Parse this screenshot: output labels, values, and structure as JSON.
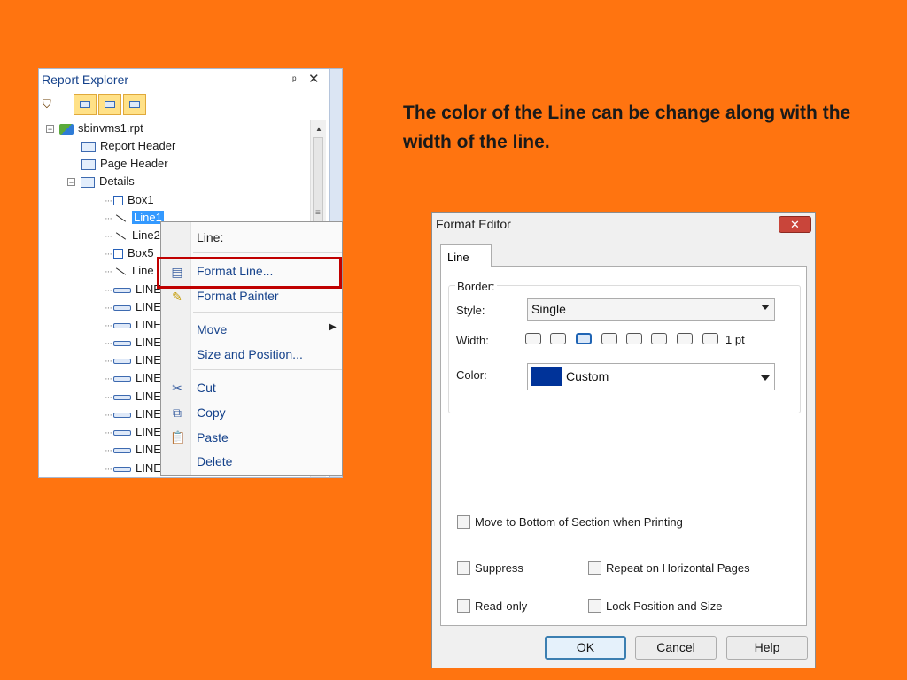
{
  "explorer": {
    "title": "Report Explorer",
    "pin_icon": "pin-icon",
    "close_icon": "close-icon",
    "tree": [
      {
        "label": "sbinvms1.rpt",
        "icon": "report-icon",
        "expander": "⊟"
      },
      {
        "label": "Report Header",
        "icon": "section-icon"
      },
      {
        "label": "Page Header",
        "icon": "section-icon"
      },
      {
        "label": "Details",
        "icon": "section-icon",
        "expander": "⊟"
      },
      {
        "label": "Box1",
        "icon": "box-icon"
      },
      {
        "label": "Line1",
        "icon": "line-icon",
        "selected": true
      },
      {
        "label": "Line2",
        "icon": "line-icon"
      },
      {
        "label": "Box5",
        "icon": "box-icon"
      },
      {
        "label": "Line",
        "icon": "line-icon"
      },
      {
        "label": "LINE",
        "icon": "label-icon"
      },
      {
        "label": "LINE",
        "icon": "label-icon"
      },
      {
        "label": "LINE",
        "icon": "label-icon"
      },
      {
        "label": "LINE",
        "icon": "label-icon"
      },
      {
        "label": "LINE",
        "icon": "label-icon"
      },
      {
        "label": "LINE",
        "icon": "label-icon"
      },
      {
        "label": "LINE",
        "icon": "label-icon"
      },
      {
        "label": "LINE",
        "icon": "label-icon"
      },
      {
        "label": "LINE",
        "icon": "label-icon"
      },
      {
        "label": "LINE",
        "icon": "label-icon"
      },
      {
        "label": "LINE",
        "icon": "label-icon"
      }
    ]
  },
  "context_menu": {
    "header": "Line:",
    "items": {
      "format_line": "Format Line...",
      "format_painter": "Format Painter",
      "move": "Move",
      "size_position": "Size and Position...",
      "cut": "Cut",
      "copy": "Copy",
      "paste": "Paste",
      "delete": "Delete"
    },
    "highlight_color": "#c00000"
  },
  "caption": "The color of the Line can be change along with the width of the line.",
  "dialog": {
    "title": "Format Editor",
    "tab": "Line",
    "border_group": "Border:",
    "style_label": "Style:",
    "style_value": "Single",
    "width_label": "Width:",
    "width_value": "1 pt",
    "color_label": "Color:",
    "color_value": "Custom",
    "color_swatch": "#003399",
    "options": {
      "move_to_bottom": "Move to Bottom of Section when Printing",
      "suppress": "Suppress",
      "repeat": "Repeat on Horizontal Pages",
      "read_only": "Read-only",
      "lock": "Lock Position and Size"
    },
    "buttons": {
      "ok": "OK",
      "cancel": "Cancel",
      "help": "Help"
    }
  },
  "colors": {
    "background": "#ff7410",
    "accent": "#3399ff"
  }
}
